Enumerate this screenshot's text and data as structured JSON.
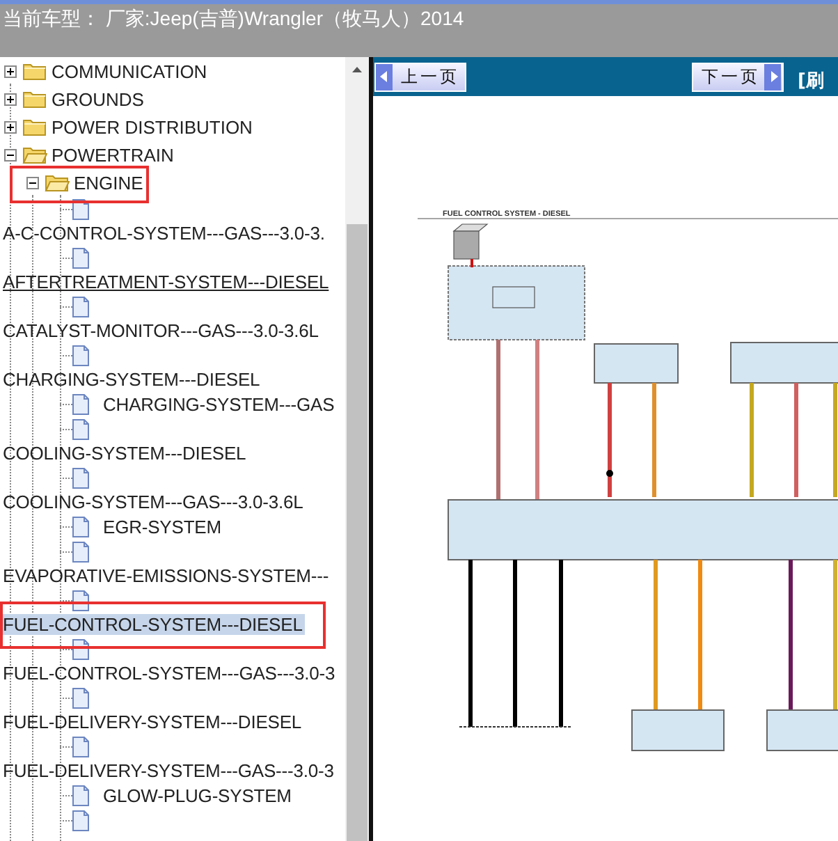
{
  "title_bar": {
    "text": "当前车型： 厂家:Jeep(吉普)Wrangler（牧马人）2014"
  },
  "tree": [
    {
      "kind": "folder",
      "label": "COMMUNICATION",
      "expanded": false
    },
    {
      "kind": "folder",
      "label": "GROUNDS",
      "expanded": false
    },
    {
      "kind": "folder",
      "label": "POWER DISTRIBUTION",
      "expanded": false
    },
    {
      "kind": "folder",
      "label": "POWERTRAIN",
      "expanded": true,
      "children": [
        {
          "kind": "folder",
          "label": "ENGINE",
          "expanded": true,
          "annotated": true,
          "children": [
            {
              "kind": "below",
              "label": "A-C-CONTROL-SYSTEM---GAS---3.0-3.",
              "selected": false,
              "hovered": false
            },
            {
              "kind": "below",
              "label": "AFTERTREATMENT-SYSTEM---DIESEL",
              "selected": false,
              "hovered": true
            },
            {
              "kind": "below",
              "label": "CATALYST-MONITOR---GAS---3.0-3.6L",
              "selected": false,
              "hovered": false
            },
            {
              "kind": "below",
              "label": "CHARGING-SYSTEM---DIESEL",
              "selected": false,
              "hovered": false
            },
            {
              "kind": "inline",
              "label": "CHARGING-SYSTEM---GAS",
              "selected": false,
              "hovered": false
            },
            {
              "kind": "below",
              "label": "COOLING-SYSTEM---DIESEL",
              "selected": false,
              "hovered": false
            },
            {
              "kind": "below",
              "label": "COOLING-SYSTEM---GAS---3.0-3.6L",
              "selected": false,
              "hovered": false
            },
            {
              "kind": "inline",
              "label": "EGR-SYSTEM",
              "selected": false,
              "hovered": false
            },
            {
              "kind": "below",
              "label": "EVAPORATIVE-EMISSIONS-SYSTEM---",
              "selected": false,
              "hovered": false
            },
            {
              "kind": "below",
              "label": "FUEL-CONTROL-SYSTEM---DIESEL",
              "selected": true,
              "hovered": false,
              "annotated": true
            },
            {
              "kind": "below",
              "label": "FUEL-CONTROL-SYSTEM---GAS---3.0-3",
              "selected": false,
              "hovered": false
            },
            {
              "kind": "below",
              "label": "FUEL-DELIVERY-SYSTEM---DIESEL",
              "selected": false,
              "hovered": false
            },
            {
              "kind": "below",
              "label": "FUEL-DELIVERY-SYSTEM---GAS---3.0-3",
              "selected": false,
              "hovered": false
            },
            {
              "kind": "inline",
              "label": "GLOW-PLUG-SYSTEM",
              "selected": false,
              "hovered": false
            },
            {
              "kind": "below"
            }
          ]
        }
      ]
    }
  ],
  "toolbar": {
    "prev_button": "上一页",
    "next_button": "下一页",
    "refresh_link": "[刷"
  },
  "diagram": {
    "title": "FUEL CONTROL SYSTEM - DIESEL"
  }
}
